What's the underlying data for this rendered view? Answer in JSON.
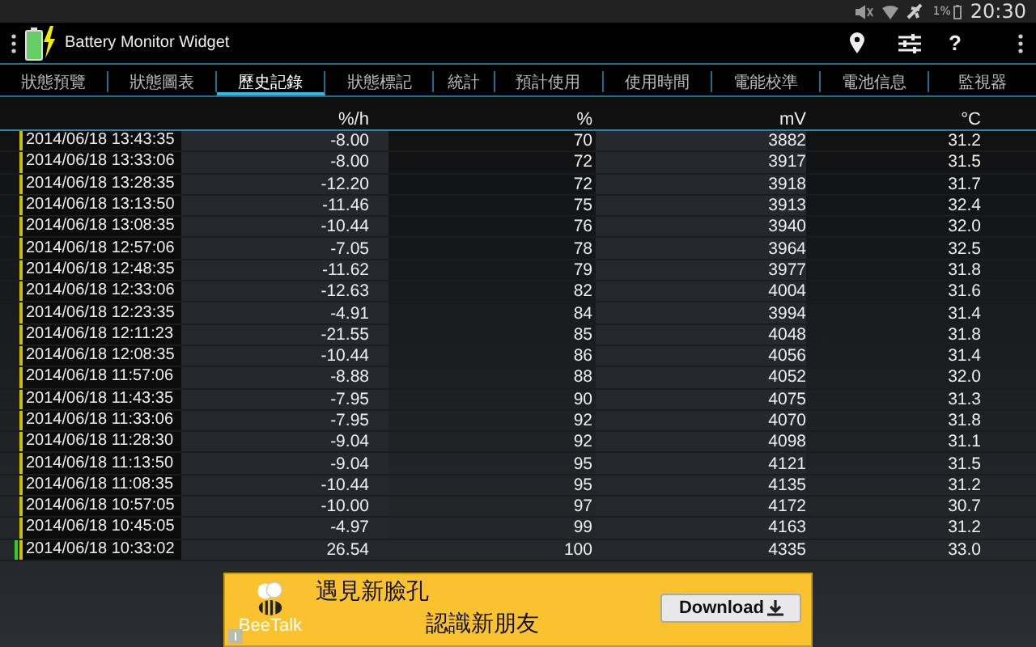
{
  "status_bar": {
    "battery": "1%",
    "time": "20:30"
  },
  "app_bar": {
    "title": "Battery Monitor Widget",
    "help": "?"
  },
  "tabs": [
    {
      "label": "狀態預覽",
      "selected": false
    },
    {
      "label": "狀態圖表",
      "selected": false
    },
    {
      "label": "歷史記錄",
      "selected": true
    },
    {
      "label": "狀態標記",
      "selected": false
    },
    {
      "label": "統計",
      "selected": false
    },
    {
      "label": "預計使用",
      "selected": false
    },
    {
      "label": "使用時間",
      "selected": false
    },
    {
      "label": "電能校準",
      "selected": false
    },
    {
      "label": "電池信息",
      "selected": false
    },
    {
      "label": "監視器",
      "selected": false
    }
  ],
  "table": {
    "columns": [
      "%/h",
      "%",
      "mV",
      "°C"
    ],
    "rows": [
      {
        "time": "2014/06/18 13:43:35",
        "rate": "-8.00",
        "percent": "70",
        "mv": "3882",
        "temp": "31.2",
        "charging": false
      },
      {
        "time": "2014/06/18 13:33:06",
        "rate": "-8.00",
        "percent": "72",
        "mv": "3917",
        "temp": "31.5",
        "charging": false
      },
      {
        "time": "2014/06/18 13:28:35",
        "rate": "-12.20",
        "percent": "72",
        "mv": "3918",
        "temp": "31.7",
        "charging": false
      },
      {
        "time": "2014/06/18 13:13:50",
        "rate": "-11.46",
        "percent": "75",
        "mv": "3913",
        "temp": "32.4",
        "charging": false
      },
      {
        "time": "2014/06/18 13:08:35",
        "rate": "-10.44",
        "percent": "76",
        "mv": "3940",
        "temp": "32.0",
        "charging": false
      },
      {
        "time": "2014/06/18 12:57:06",
        "rate": "-7.05",
        "percent": "78",
        "mv": "3964",
        "temp": "32.5",
        "charging": false
      },
      {
        "time": "2014/06/18 12:48:35",
        "rate": "-11.62",
        "percent": "79",
        "mv": "3977",
        "temp": "31.8",
        "charging": false
      },
      {
        "time": "2014/06/18 12:33:06",
        "rate": "-12.63",
        "percent": "82",
        "mv": "4004",
        "temp": "31.6",
        "charging": false
      },
      {
        "time": "2014/06/18 12:23:35",
        "rate": "-4.91",
        "percent": "84",
        "mv": "3994",
        "temp": "31.4",
        "charging": false
      },
      {
        "time": "2014/06/18 12:11:23",
        "rate": "-21.55",
        "percent": "85",
        "mv": "4048",
        "temp": "31.8",
        "charging": false
      },
      {
        "time": "2014/06/18 12:08:35",
        "rate": "-10.44",
        "percent": "86",
        "mv": "4056",
        "temp": "31.4",
        "charging": false
      },
      {
        "time": "2014/06/18 11:57:06",
        "rate": "-8.88",
        "percent": "88",
        "mv": "4052",
        "temp": "32.0",
        "charging": false
      },
      {
        "time": "2014/06/18 11:43:35",
        "rate": "-7.95",
        "percent": "90",
        "mv": "4075",
        "temp": "31.3",
        "charging": false
      },
      {
        "time": "2014/06/18 11:33:06",
        "rate": "-7.95",
        "percent": "92",
        "mv": "4070",
        "temp": "31.8",
        "charging": false
      },
      {
        "time": "2014/06/18 11:28:30",
        "rate": "-9.04",
        "percent": "92",
        "mv": "4098",
        "temp": "31.1",
        "charging": false
      },
      {
        "time": "2014/06/18 11:13:50",
        "rate": "-9.04",
        "percent": "95",
        "mv": "4121",
        "temp": "31.5",
        "charging": false
      },
      {
        "time": "2014/06/18 11:08:35",
        "rate": "-10.44",
        "percent": "95",
        "mv": "4135",
        "temp": "31.2",
        "charging": false
      },
      {
        "time": "2014/06/18 10:57:05",
        "rate": "-10.00",
        "percent": "97",
        "mv": "4172",
        "temp": "30.7",
        "charging": false
      },
      {
        "time": "2014/06/18 10:45:05",
        "rate": "-4.97",
        "percent": "99",
        "mv": "4163",
        "temp": "31.2",
        "charging": false
      },
      {
        "time": "2014/06/18 10:33:02",
        "rate": "26.54",
        "percent": "100",
        "mv": "4335",
        "temp": "33.0",
        "charging": true
      }
    ]
  },
  "ad": {
    "brand": "BeeTalk",
    "line_1": "遇見新臉孔",
    "line_2": "認識新朋友",
    "button": "Download"
  }
}
